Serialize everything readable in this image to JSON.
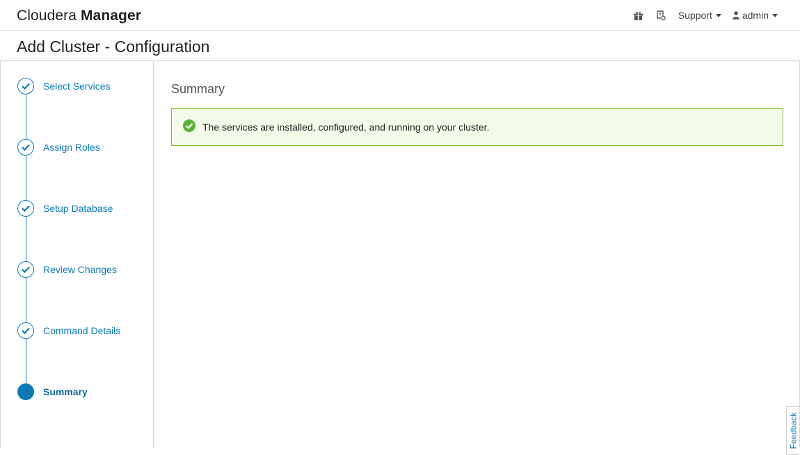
{
  "header": {
    "brand_light": "Cloudera",
    "brand_bold": "Manager",
    "support_label": "Support",
    "user_label": "admin"
  },
  "page": {
    "title": "Add Cluster - Configuration"
  },
  "wizard": {
    "steps": [
      {
        "label": "Select Services",
        "state": "complete"
      },
      {
        "label": "Assign Roles",
        "state": "complete"
      },
      {
        "label": "Setup Database",
        "state": "complete"
      },
      {
        "label": "Review Changes",
        "state": "complete"
      },
      {
        "label": "Command Details",
        "state": "complete"
      },
      {
        "label": "Summary",
        "state": "current"
      }
    ]
  },
  "content": {
    "section_title": "Summary",
    "alert_message": "The services are installed, configured, and running on your cluster."
  },
  "feedback": {
    "label": "Feedback"
  },
  "colors": {
    "accent": "#0a7ab5",
    "success_border": "#7cbf2d",
    "success_bg": "#f2fae8",
    "success_icon": "#5cb230"
  },
  "icons": {
    "gift": "gift-icon",
    "tour": "tour-icon",
    "user": "user-icon",
    "check": "check-icon",
    "success": "check-circle-icon"
  }
}
